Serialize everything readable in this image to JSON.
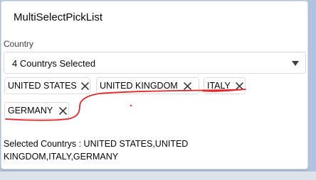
{
  "card": {
    "title": "MultiSelectPickList"
  },
  "country_field": {
    "label": "Country",
    "value": "4 Countrys Selected"
  },
  "pills": [
    {
      "label": "UNITED STATES"
    },
    {
      "label": "UNITED KINGDOM"
    },
    {
      "label": "ITALY"
    },
    {
      "label": "GERMANY"
    }
  ],
  "summary": {
    "line1": "Selected Countrys : UNITED STATES,UNITED",
    "line2": "KINGDOM,ITALY,GERMANY"
  },
  "icons": {
    "dropdown": "chevron-down-icon",
    "remove": "close-icon"
  },
  "colors": {
    "annotation": "#e5262b",
    "page_background": "#b0c4df"
  }
}
